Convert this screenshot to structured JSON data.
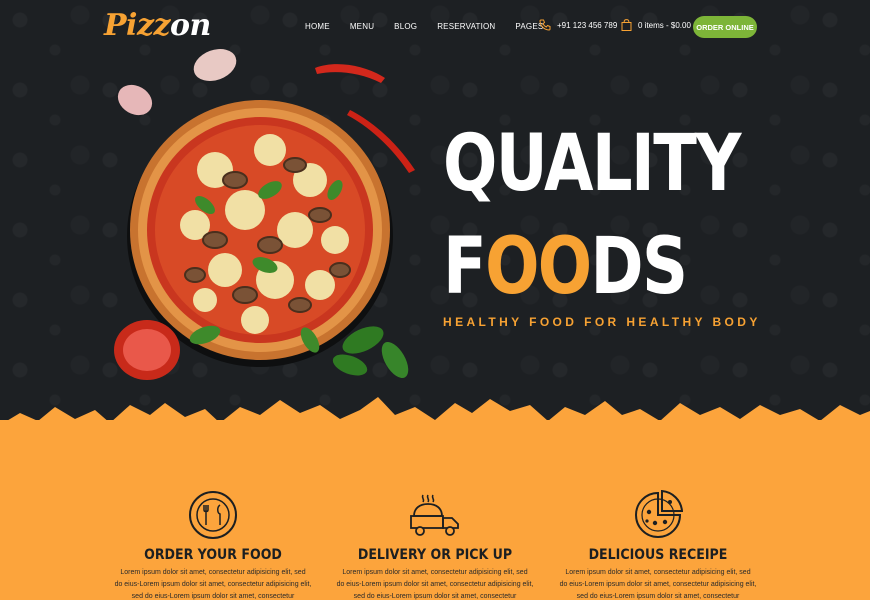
{
  "brand": {
    "logo_accent": "Pizz",
    "logo_rest": "on"
  },
  "nav": [
    {
      "label": "HOME"
    },
    {
      "label": "MENU"
    },
    {
      "label": "BLOG"
    },
    {
      "label": "RESERVATION"
    },
    {
      "label": "PAGES"
    }
  ],
  "contact": {
    "phone": "+91 123 456 789",
    "phone_icon": "phone-icon"
  },
  "cart": {
    "label": "0 items - $0.00",
    "icon": "bag-icon"
  },
  "cta": {
    "label": "ORDER ONLINE"
  },
  "hero": {
    "line1": "QUALITY",
    "line2_a": "F",
    "line2_b": "OO",
    "line2_c": "DS",
    "tagline": "HEALTHY FOOD FOR HEALTHY BODY"
  },
  "features": [
    {
      "icon": "utensils-plate-icon",
      "title": "ORDER YOUR FOOD",
      "text1": "Lorem ipsum dolor sit amet, consectetur adipisicing elit, sed",
      "text2": "do eius-Lorem ipsum dolor sit amet, consectetur adipisicing elit,",
      "text3": "sed do eius-Lorem ipsum dolor sit amet, consectetur"
    },
    {
      "icon": "delivery-truck-icon",
      "title": "DELIVERY OR PICK UP",
      "text1": "Lorem ipsum dolor sit amet, consectetur adipisicing elit, sed",
      "text2": "do eius-Lorem ipsum dolor sit amet, consectetur adipisicing elit,",
      "text3": "sed do eius-Lorem ipsum dolor sit amet, consectetur"
    },
    {
      "icon": "pizza-slice-icon",
      "title": "DELICIOUS RECEIPE",
      "text1": "Lorem ipsum dolor sit amet, consectetur adipisicing elit, sed",
      "text2": "do eius-Lorem ipsum dolor sit amet, consectetur adipisicing elit,",
      "text3": "sed do eius-Lorem ipsum dolor sit amet, consectetur"
    }
  ],
  "colors": {
    "accent": "#f7a233",
    "cta": "#7db538",
    "dark": "#1d2023",
    "band": "#fca43c"
  }
}
